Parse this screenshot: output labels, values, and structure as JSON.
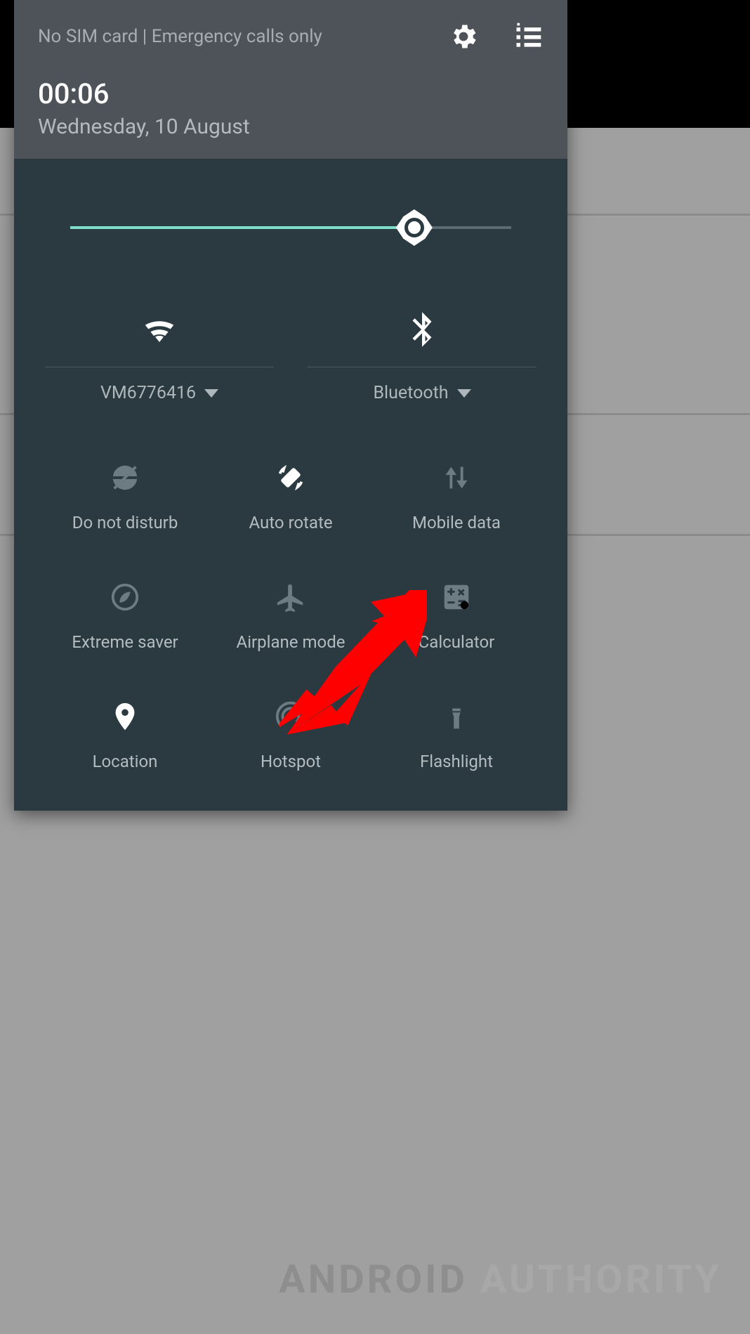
{
  "status_bar": {
    "text": "No SIM card | Emergency calls only"
  },
  "header": {
    "time": "00:06",
    "date": "Wednesday, 10 August"
  },
  "brightness": {
    "percent": 78
  },
  "wide_tiles": {
    "wifi": {
      "label": "VM6776416",
      "icon": "wifi-icon"
    },
    "bluetooth": {
      "label": "Bluetooth",
      "icon": "bluetooth-icon"
    }
  },
  "tiles": [
    {
      "key": "dnd",
      "label": "Do not disturb",
      "icon": "dnd-icon",
      "active": false
    },
    {
      "key": "autorotate",
      "label": "Auto rotate",
      "icon": "autorotate-icon",
      "active": true
    },
    {
      "key": "mobiledata",
      "label": "Mobile data",
      "icon": "mobiledata-icon",
      "active": false
    },
    {
      "key": "saver",
      "label": "Extreme saver",
      "icon": "leaf-icon",
      "active": false
    },
    {
      "key": "airplane",
      "label": "Airplane mode",
      "icon": "airplane-icon",
      "active": false
    },
    {
      "key": "calculator",
      "label": "Calculator",
      "icon": "calculator-icon",
      "active": false
    },
    {
      "key": "location",
      "label": "Location",
      "icon": "location-icon",
      "active": true
    },
    {
      "key": "hotspot",
      "label": "Hotspot",
      "icon": "hotspot-icon",
      "active": false
    },
    {
      "key": "flashlight",
      "label": "Flashlight",
      "icon": "flashlight-icon",
      "active": false
    }
  ],
  "watermark": {
    "part1": "ANDROID ",
    "part2": "AUTHORITY"
  },
  "annotation": {
    "type": "arrow",
    "target": "mobiledata"
  }
}
